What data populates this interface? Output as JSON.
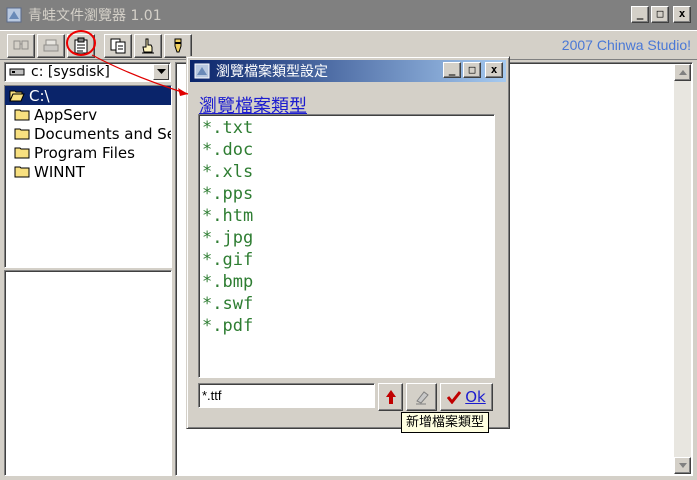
{
  "window": {
    "title": "青蛙文件瀏覽器 1.01",
    "buttons": {
      "minimize": "_",
      "maximize": "□",
      "close": "x"
    }
  },
  "toolbar": {
    "studio_label": "2007 Chinwa Studio!",
    "buttons": [
      "search-icon",
      "print-icon",
      "file-type-settings-icon",
      "copy-icon",
      "hand-pointer-icon",
      "marker-icon"
    ]
  },
  "drive": {
    "label": "c: [sysdisk]"
  },
  "tree": {
    "root": "C:\\",
    "items": [
      "AppServ",
      "Documents and Settings",
      "Program Files",
      "WINNT"
    ]
  },
  "dialog": {
    "title": "瀏覽檔案類型設定",
    "heading": "瀏覽檔案類型",
    "extensions": [
      "*.txt",
      "*.doc",
      "*.xls",
      "*.pps",
      "*.htm",
      "*.jpg",
      "*.gif",
      "*.bmp",
      "*.swf",
      "*.pdf"
    ],
    "input_value": "*.ttf",
    "ok_label": "Ok",
    "tooltip": "新增檔案類型"
  },
  "colors": {
    "title_active": "#0a246a",
    "title_inactive": "#808080",
    "selection": "#0a246a",
    "extension_text": "#2e7d32",
    "link_blue": "#1c1ccf",
    "studio_blue": "#4a78d6",
    "annotation_red": "#e00000"
  }
}
